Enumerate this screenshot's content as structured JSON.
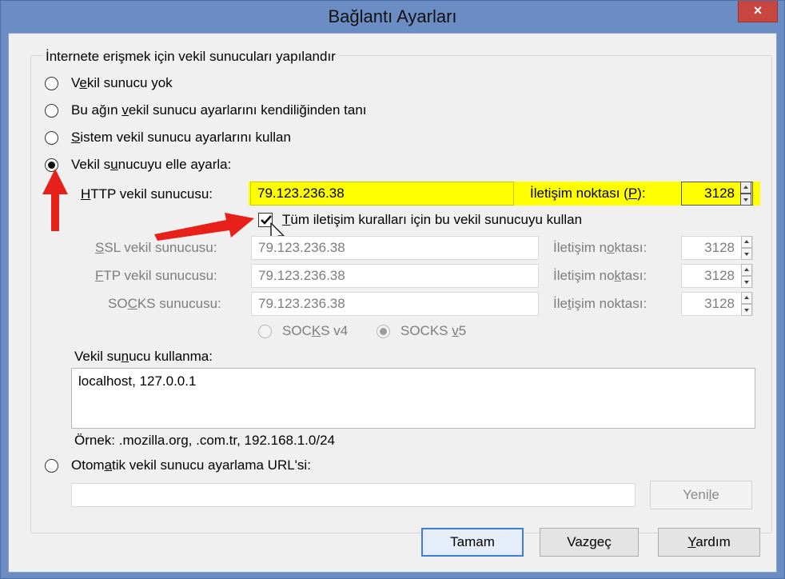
{
  "window": {
    "title": "Bağlantı Ayarları",
    "close_label": "×"
  },
  "group_label": "İnternete erişmek için vekil sunucuları yapılandır",
  "options": {
    "no_proxy": {
      "pre": "V",
      "u": "e",
      "post": "kil sunucu yok"
    },
    "auto_detect": {
      "pre": "Bu ağın ",
      "u": "v",
      "post": "ekil sunucu ayarlarını kendiliğinden tanı"
    },
    "system": {
      "pre": "",
      "u": "S",
      "post": "istem vekil sunucu ayarlarını kullan"
    },
    "manual": {
      "pre": "Vekil s",
      "u": "u",
      "post": "nucuyu elle ayarla:"
    },
    "auto_url": {
      "pre": "Otom",
      "u": "a",
      "post": "tik vekil sunucu ayarlama URL'si:"
    }
  },
  "http": {
    "label_u": "H",
    "label_rest": "TTP vekil sunucusu:",
    "value": "79.123.236.38",
    "port_label_pre": "İletişim noktası (",
    "port_label_u": "P",
    "port_label_post": "):",
    "port": "3128"
  },
  "use_all": {
    "u": "T",
    "rest": "üm iletişim kuralları için bu vekil sunucuyu kullan",
    "checked": true
  },
  "ssl": {
    "label_u": "S",
    "label_rest": "SL vekil sunucusu:",
    "value": "79.123.236.38",
    "port_label_pre": "İletişim n",
    "port_label_u": "o",
    "port_label_post": "ktası:",
    "port": "3128"
  },
  "ftp": {
    "label_u": "F",
    "label_rest": "TP vekil sunucusu:",
    "value": "79.123.236.38",
    "port_label_pre": "İletişim no",
    "port_label_u": "k",
    "port_label_post": "tası:",
    "port": "3128"
  },
  "socks": {
    "label_pre": "SO",
    "label_u": "C",
    "label_rest": "KS sunucusu:",
    "value": "79.123.236.38",
    "port_label_pre": "İle",
    "port_label_u": "t",
    "port_label_post": "işim noktası:",
    "port": "3128"
  },
  "socks_versions": {
    "v4": {
      "pre": "SOC",
      "u": "K",
      "post": "S v4"
    },
    "v5": {
      "pre": "SOCKS ",
      "u": "v",
      "post": "5"
    }
  },
  "no_proxy_for": {
    "label_pre": "Vekil su",
    "label_u": "n",
    "label_post": "ucu kullanma:",
    "value": "localhost, 127.0.0.1",
    "example": "Örnek: .mozilla.org, .com.tr, 192.168.1.0/24"
  },
  "auto_url_value": "",
  "buttons": {
    "reload_pre": "Yeni",
    "reload_u": "l",
    "reload_post": "e",
    "ok": "Tamam",
    "cancel": "Vazgeç",
    "help_u": "Y",
    "help_rest": "ardım"
  },
  "colors": {
    "highlight": "#ffff00",
    "annotation_arrow": "#e8201a",
    "title_bar": "#6c8dc4",
    "close_button": "#c7463f"
  }
}
